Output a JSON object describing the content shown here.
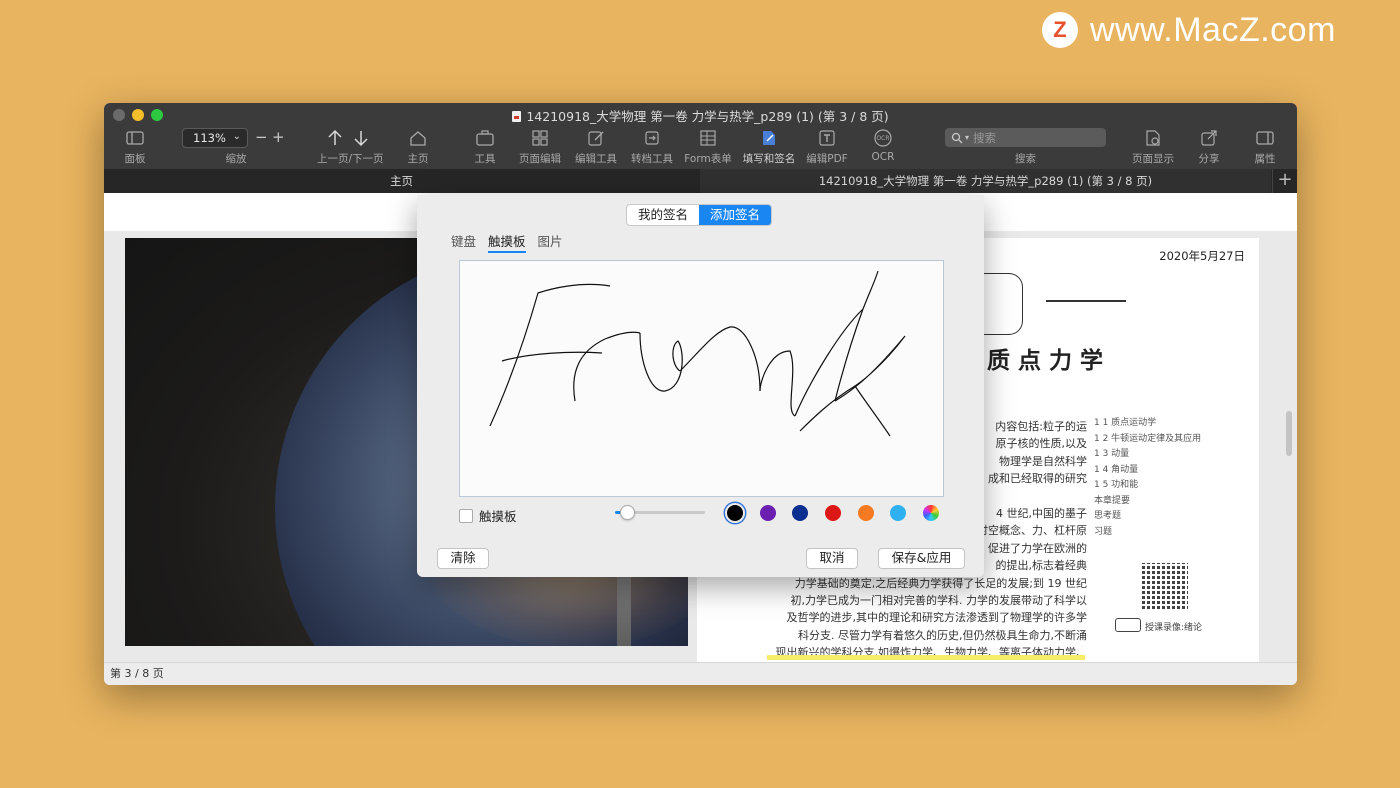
{
  "watermark": {
    "logo_letter": "Z",
    "text": "www.MacZ.com"
  },
  "window": {
    "title": "14210918_大学物理  第一卷  力学与热学_p289 (1) (第 3 / 8 页)"
  },
  "toolbar": {
    "panel": "面板",
    "zoom_value": "113%",
    "zoom_label": "缩放",
    "zoom_minus": "−",
    "zoom_plus": "+",
    "prevnext": "上一页/下一页",
    "home": "主页",
    "tools": "工具",
    "page_edit": "页面编辑",
    "edit_tools": "编辑工具",
    "convert_tools": "转档工具",
    "form": "Form表单",
    "fill_sign": "填写和签名",
    "edit_pdf": "编辑PDF",
    "ocr": "OCR",
    "search_placeholder": "搜索",
    "search_label": "搜索",
    "page_display": "页面显示",
    "share": "分享",
    "properties": "属性"
  },
  "tabs": {
    "home": "主页",
    "document": "14210918_大学物理  第一卷  力学与热学_p289 (1) (第 3 / 8 页)",
    "plus": "+"
  },
  "pdf_page": {
    "date": "2020年5月27日",
    "heading": "质点力学",
    "body_lines": "内容包括:粒子的运\n原子核的性质,以及\n物理学是自然科学\n成和已经取得的研究\n\n4 世纪,中国的墨子\n时空概念、力、杠杆原\n促进了力学在欧洲的\n的提出,标志着经典\n力学基础的奠定,之后经典力学获得了长足的发展;到 19 世纪\n初,力学已成为一门相对完善的学科. 力学的发展带动了科学以\n及哲学的进步,其中的理论和研究方法渗透到了物理学的许多学\n科分支. 尽管力学有着悠久的历史,但仍然极具生命力,不断涌\n现出新兴的学科分支,如爆炸力学、生物力学、等离子体动力学、",
    "toc": "1 1   质点运动学\n1 2   牛顿运动定律及其应用\n1 3   动量\n1 4   角动量\n1 5   功和能\n本章提要\n思考题\n习题",
    "video_label": "授课录像:绪论"
  },
  "status": {
    "page": "第 3 / 8 页"
  },
  "dialog": {
    "seg_my": "我的签名",
    "seg_add": "添加签名",
    "tab_keyboard": "键盘",
    "tab_touchpad": "触摸板",
    "tab_image": "图片",
    "signature_text": "Frank",
    "touchpad_label": "触摸板",
    "stroke_width": 0.1,
    "colors": [
      "#000000",
      "#6a1fb0",
      "#0b2f8f",
      "#dd1616",
      "#f57a22",
      "#2fb0f0",
      "rainbow"
    ],
    "selected_color": "#000000",
    "clear": "清除",
    "cancel": "取消",
    "save_apply": "保存&应用"
  }
}
